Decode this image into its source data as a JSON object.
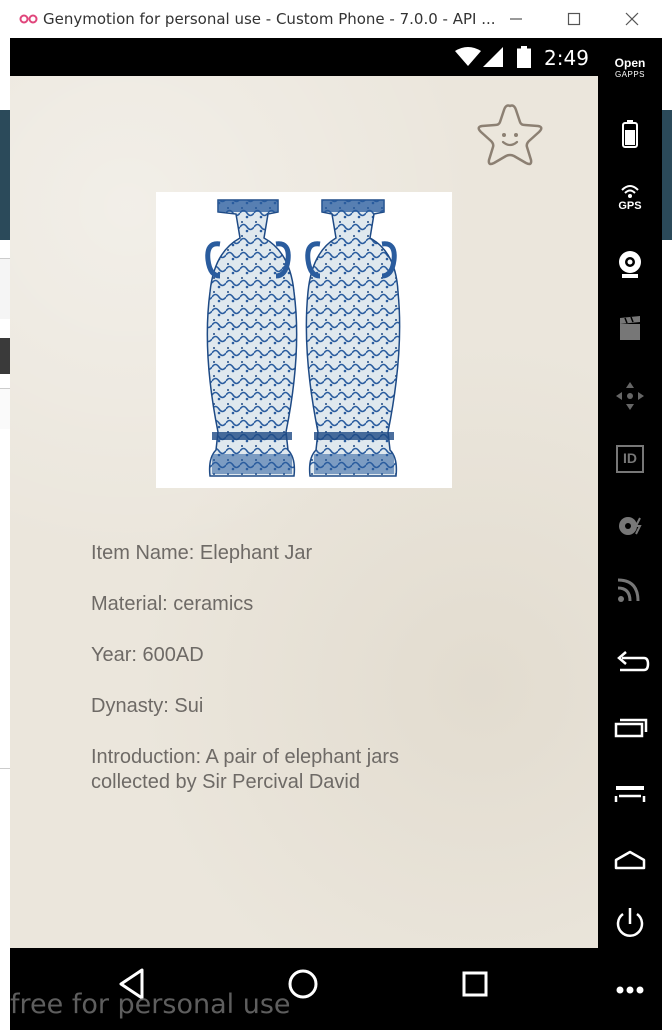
{
  "window": {
    "title": "Genymotion for personal use - Custom Phone - 7.0.0 - API ...",
    "watermark": "free for personal use"
  },
  "status_bar": {
    "time": "2:49"
  },
  "sidebar": {
    "gapps_line1": "Open",
    "gapps_line2": "GAPPS",
    "gps_label": "GPS",
    "id_label": "ID"
  },
  "item": {
    "name": "Item Name: Elephant Jar",
    "material": "Material: ceramics",
    "year": "Year: 600AD",
    "dynasty": "Dynasty: Sui",
    "introduction_line1": "Introduction: A pair of elephant jars",
    "introduction_line2": "collected by Sir Percival David"
  },
  "colors": {
    "page_background": "#ebe6dc",
    "text": "#6e6a66",
    "porcelain_blue": "#2a5c9e",
    "star_outline": "#8c8073"
  }
}
